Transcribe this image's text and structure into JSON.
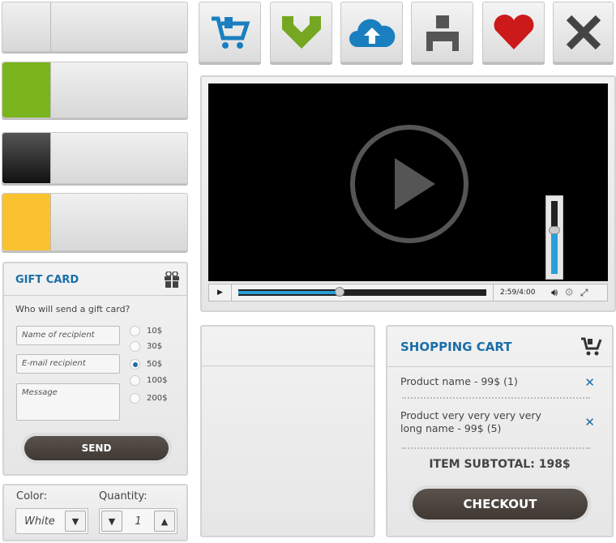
{
  "color_bars": [
    {
      "swatch": "#e6e6e6"
    },
    {
      "swatch": "#7ab51d"
    },
    {
      "swatch": "#333333"
    },
    {
      "swatch": "#f9c22e"
    }
  ],
  "icon_buttons": [
    {
      "icon": "shopping-cart-icon",
      "color": "#1a7fbf"
    },
    {
      "icon": "download-icon",
      "color": "#76a722"
    },
    {
      "icon": "cloud-upload-icon",
      "color": "#1a7fbf"
    },
    {
      "icon": "user-icon",
      "color": "#555555"
    },
    {
      "icon": "heart-icon",
      "color": "#cc1a1a"
    },
    {
      "icon": "close-icon",
      "color": "#444444"
    }
  ],
  "video": {
    "time": "2:59/4:00",
    "progress_percent": 41,
    "volume_percent": 60
  },
  "gift_card": {
    "title": "GIFT CARD",
    "question": "Who will send a gift card?",
    "name_placeholder": "Name of recipient",
    "email_placeholder": "E-mail recipient",
    "message_placeholder": "Message",
    "amounts": [
      "10$",
      "30$",
      "50$",
      "100$",
      "200$"
    ],
    "selected": "50$",
    "send": "SEND"
  },
  "options": {
    "color_label": "Color:",
    "color_value": "White",
    "quantity_label": "Quantity:",
    "quantity_value": "1"
  },
  "cart": {
    "title": "SHOPPING CART",
    "items": [
      {
        "line1": "Product name - 99$ (1)",
        "line2": ""
      },
      {
        "line1": "Product very very very very",
        "line2": "long name - 99$ (5)"
      }
    ],
    "subtotal": "ITEM SUBTOTAL: 198$",
    "checkout": "CHECKOUT"
  }
}
